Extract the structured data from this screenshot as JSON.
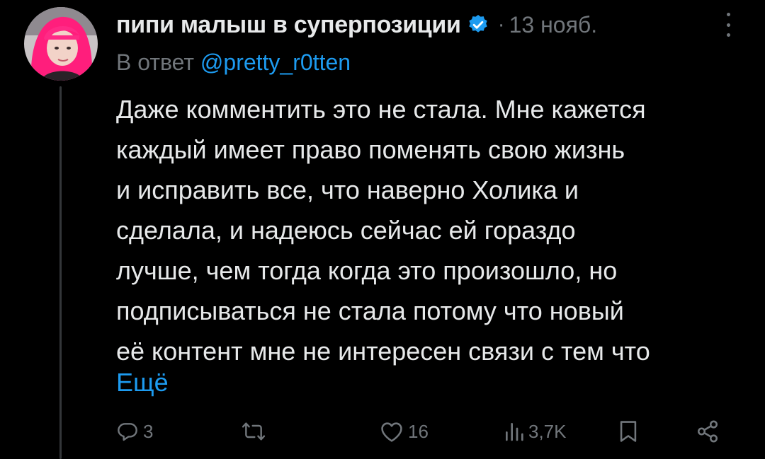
{
  "post": {
    "display_name": "пипи малыш в суперпозиции",
    "separator": "·",
    "date": "13 нояб.",
    "reply_prefix": "В ответ",
    "reply_handle": "@pretty_r0tten",
    "text_lines": [
      "Даже комментить это не стала. Мне кажется",
      "каждый имеет право поменять свою жизнь",
      "и исправить все, что наверно Холика и",
      "сделала, и надеюсь сейчас ей гораздо",
      "лучше, чем тогда когда это произошло, но",
      "подписываться не стала потому что новый",
      "её контент мне не интересен связи с тем что"
    ],
    "show_more": "Ещё"
  },
  "actions": {
    "replies": "3",
    "likes": "16",
    "views": "3,7K"
  },
  "colors": {
    "background": "#000000",
    "text": "#e7e9ea",
    "secondary": "#71767b",
    "accent": "#1d9bf0"
  },
  "icons": [
    "more-icon",
    "verified-badge-icon",
    "reply-icon",
    "retweet-icon",
    "like-icon",
    "views-icon",
    "bookmark-icon",
    "share-icon"
  ]
}
